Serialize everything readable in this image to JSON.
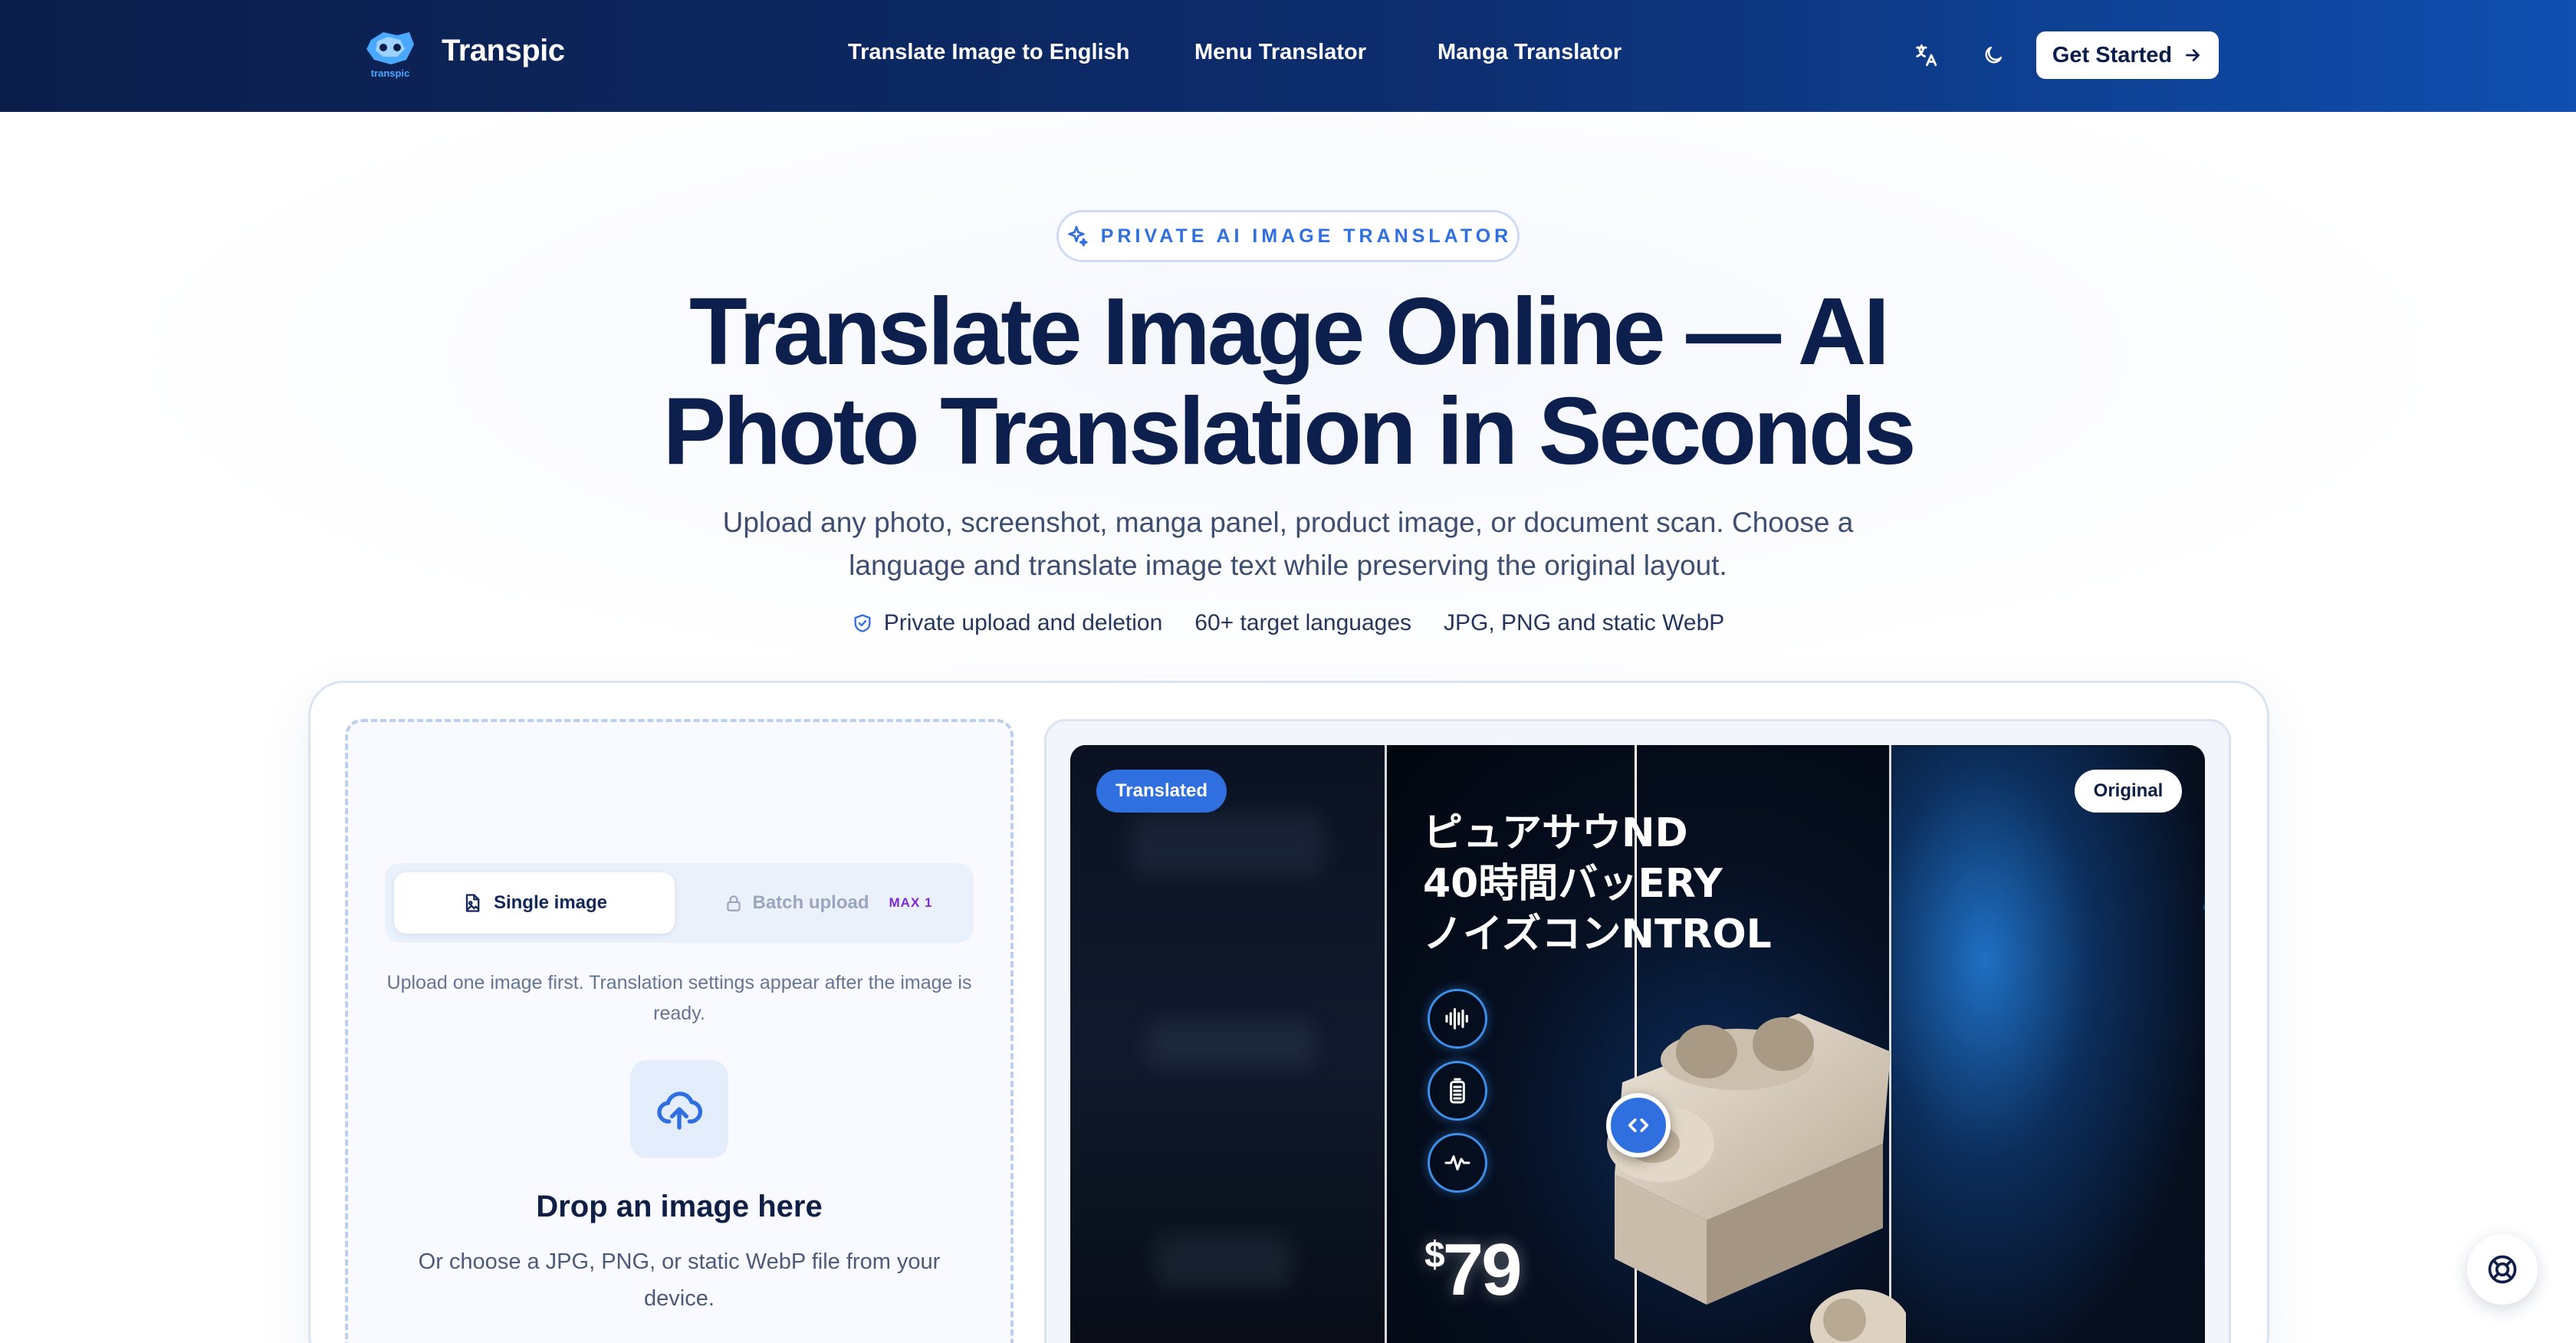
{
  "header": {
    "brand": "Transpic",
    "logo_text": "transpic",
    "nav": [
      {
        "label": "Translate Image to English"
      },
      {
        "label": "Menu Translator"
      },
      {
        "label": "Manga Translator"
      }
    ],
    "icons": {
      "language": "translate-icon",
      "theme": "moon-icon",
      "arrow": "arrow-right-icon"
    },
    "cta_label": "Get Started"
  },
  "hero": {
    "badge": "PRIVATE AI IMAGE TRANSLATOR",
    "title": "Translate Image Online — AI Photo Translation in Seconds",
    "subtitle": "Upload any photo, screenshot, manga panel, product image, or document scan. Choose a language and translate image text while preserving the original layout.",
    "features": [
      "Private upload and deletion",
      "60+ target languages",
      "JPG, PNG and static WebP"
    ]
  },
  "upload": {
    "tab_single": "Single image",
    "tab_batch": "Batch upload",
    "batch_badge": "MAX 1",
    "hint": "Upload one image first. Translation settings appear after the image is ready.",
    "drop_title": "Drop an image here",
    "drop_sub": "Or choose a JPG, PNG, or static WebP file from your device."
  },
  "preview": {
    "tag_translated": "Translated",
    "tag_original": "Original",
    "product_lines": [
      "ピュアサウND",
      "40時間バッERY",
      "ノイズコンNTROL"
    ],
    "currency": "$",
    "price": "79"
  },
  "colors": {
    "accent": "#2f6fe0",
    "header_dark": "#0b1e4a",
    "header_light": "#0f4fb0",
    "title": "#0d1f4d",
    "batch_badge": "#7a2ad8"
  }
}
